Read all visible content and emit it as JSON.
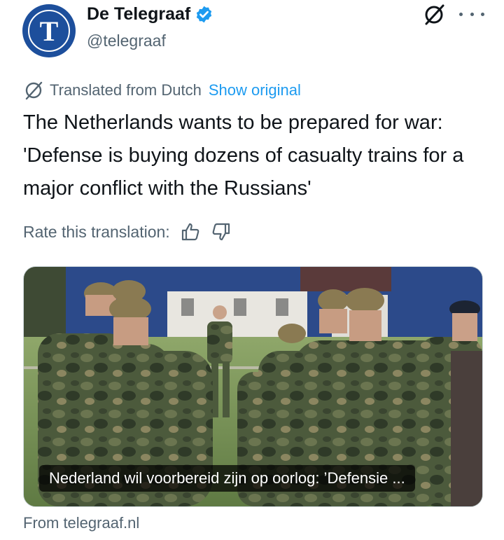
{
  "author": {
    "display_name": "De Telegraaf",
    "handle": "@telegraaf",
    "avatar_letter": "T",
    "verified": true,
    "avatar_color": "#1d4f9c"
  },
  "translation": {
    "label": "Translated from Dutch",
    "show_original": "Show original",
    "icon": "translate-globe-icon"
  },
  "tweet": {
    "text": "The Netherlands wants to be prepared for war: 'Defense is buying dozens of casualty trains for a major conflict with the Russians'"
  },
  "rating": {
    "label": "Rate this translation:",
    "up_icon": "thumbs-up-icon",
    "down_icon": "thumbs-down-icon"
  },
  "card": {
    "caption": "Nederland wil voorbereid zijn op oorlog: ’Defensie ...",
    "image_description": "photo-soldiers-in-camouflage-on-field"
  },
  "source": "From telegraaf.nl",
  "colors": {
    "link": "#1d9bf0",
    "muted": "#536471",
    "text": "#0f1419",
    "verified": "#1d9bf0"
  }
}
